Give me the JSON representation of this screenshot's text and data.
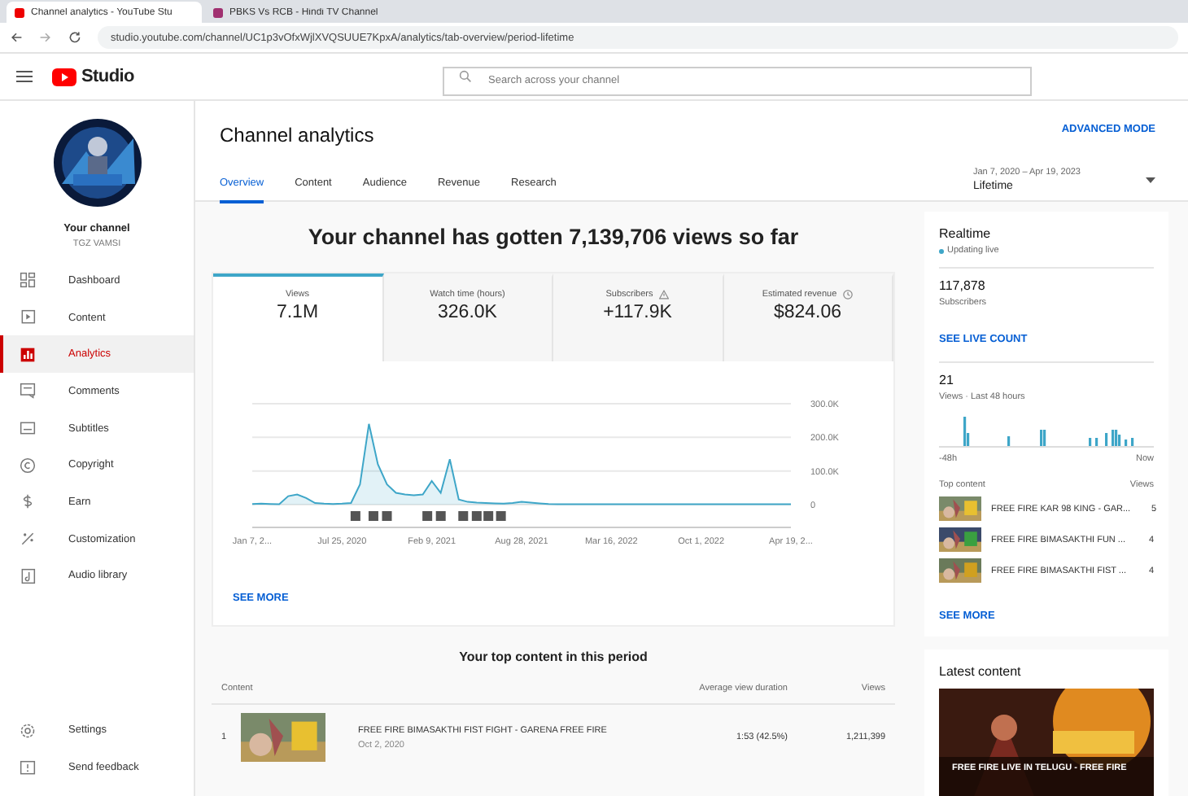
{
  "browser": {
    "tabs": [
      {
        "title": "Channel analytics - YouTube Stu",
        "selected": true
      },
      {
        "title": "PBKS Vs RCB - Hindi TV Channel",
        "selected": false
      }
    ],
    "url": "studio.youtube.com/channel/UC1p3vOfxWjlXVQSUUE7KpxA/analytics/tab-overview/period-lifetime"
  },
  "header": {
    "logo": "Studio",
    "search": {
      "placeholder": "Search across your channel"
    }
  },
  "sidebar": {
    "channel_label": "Your channel",
    "channel_name": "TGZ VAMSI",
    "items": [
      {
        "label": "Dashboard",
        "selected": false
      },
      {
        "label": "Content",
        "selected": false
      },
      {
        "label": "Analytics",
        "selected": true
      },
      {
        "label": "Comments",
        "selected": false
      },
      {
        "label": "Subtitles",
        "selected": false
      },
      {
        "label": "Copyright",
        "selected": false
      },
      {
        "label": "Earn",
        "selected": false
      },
      {
        "label": "Customization",
        "selected": false
      },
      {
        "label": "Audio library",
        "selected": false
      }
    ],
    "footer_items": [
      {
        "label": "Settings"
      },
      {
        "label": "Send feedback"
      }
    ]
  },
  "page": {
    "title": "Channel analytics",
    "advanced_mode": "ADVANCED MODE",
    "tabs": [
      {
        "label": "Overview",
        "selected": true
      },
      {
        "label": "Content",
        "selected": false
      },
      {
        "label": "Audience",
        "selected": false
      },
      {
        "label": "Revenue",
        "selected": false
      },
      {
        "label": "Research",
        "selected": false
      }
    ],
    "period": {
      "range": "Jan 7, 2020 – Apr 19, 2023",
      "label": "Lifetime"
    }
  },
  "overview": {
    "headline": "Your channel has gotten 7,139,706 views so far",
    "metrics": [
      {
        "label": "Views",
        "value": "7.1M",
        "selected": true
      },
      {
        "label": "Watch time (hours)",
        "value": "326.0K",
        "selected": false
      },
      {
        "label": "Subscribers",
        "value": "+117.9K",
        "selected": false
      },
      {
        "label": "Estimated revenue",
        "value": "$824.06",
        "selected": false
      }
    ],
    "chart_data": {
      "type": "area",
      "categories": [
        "Jan 7, 2...",
        null,
        null,
        null,
        null,
        null,
        null,
        null,
        null,
        null,
        "Jul 25, 2020",
        null,
        null,
        null,
        null,
        null,
        null,
        null,
        null,
        null,
        "Feb 9, 2021",
        null,
        null,
        null,
        null,
        null,
        null,
        null,
        null,
        null,
        "Aug 28, 2021",
        null,
        null,
        null,
        null,
        null,
        null,
        null,
        null,
        null,
        "Mar 16, 2022",
        null,
        null,
        null,
        null,
        null,
        null,
        null,
        null,
        null,
        "Oct 1, 2022",
        null,
        null,
        null,
        null,
        null,
        null,
        null,
        null,
        null,
        "Apr 19, 2..."
      ],
      "series": [
        {
          "color": "#3ea6c8",
          "values": [
            2000,
            3000,
            2000,
            1000,
            25000,
            30000,
            20000,
            5000,
            3000,
            2000,
            3000,
            5000,
            60000,
            240000,
            120000,
            60000,
            35000,
            30000,
            28000,
            30000,
            70000,
            35000,
            135000,
            15000,
            8000,
            6000,
            5000,
            4000,
            3000,
            5000,
            8000,
            6000,
            4000,
            2000,
            1000,
            1000,
            1000,
            1000,
            1000,
            1000,
            1000,
            1000,
            1000,
            1000,
            1000,
            1000,
            1000,
            1000,
            1000,
            1000,
            1000,
            1000,
            1000,
            1000,
            1000,
            1000,
            1000,
            1000,
            1000,
            1000,
            1000
          ]
        }
      ],
      "ylim": [
        0,
        300000
      ],
      "yticks": [
        {
          "value": 0,
          "label": "0"
        },
        {
          "value": 100000,
          "label": "100.0K"
        },
        {
          "value": 200000,
          "label": "200.0K"
        },
        {
          "value": 300000,
          "label": "300.0K"
        }
      ]
    },
    "see_more": "SEE MORE"
  },
  "top_content": {
    "title": "Your top content in this period",
    "columns": [
      "Content",
      "Average view duration",
      "Views"
    ],
    "rows": [
      {
        "rank": "1",
        "title": "FREE FIRE BIMASAKTHI FIST FIGHT - GARENA FREE FIRE",
        "date": "Oct 2, 2020",
        "duration": "1:53",
        "percent": "(42.5%)",
        "views": "1,211,399"
      }
    ]
  },
  "realtime": {
    "title": "Realtime",
    "status": "Updating live",
    "subscribers": "117,878",
    "subscribers_label": "Subscribers",
    "live_count": "SEE LIVE COUNT",
    "views": "21",
    "views_label": "Views · Last 48 hours",
    "axis_start": "-48h",
    "axis_end": "Now",
    "top_label": "Top content",
    "top_views_label": "Views",
    "top": [
      {
        "title": "FREE FIRE KAR 98 KING - GAR...",
        "views": "5"
      },
      {
        "title": "FREE FIRE BIMASAKTHI FUN ...",
        "views": "4"
      },
      {
        "title": "FREE FIRE BIMASAKTHI FIST ...",
        "views": "4"
      }
    ],
    "see_more": "SEE MORE"
  },
  "latest": {
    "title": "Latest content",
    "video_title": "FREE FIRE LIVE IN TELUGU - FREE FIRE"
  }
}
